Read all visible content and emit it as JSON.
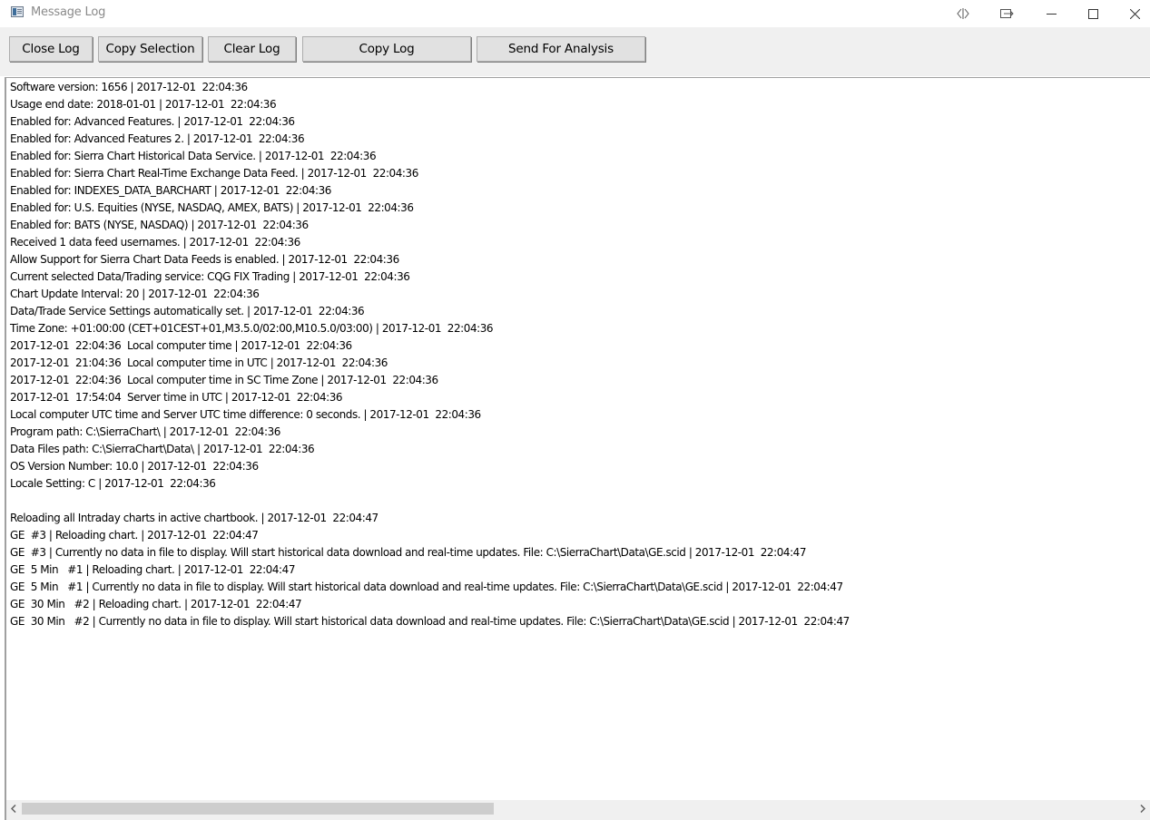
{
  "window": {
    "title": "Message Log",
    "icon": "app-window-icon"
  },
  "titlebar_buttons": [
    {
      "name": "snap-layout-icon",
      "label": ""
    },
    {
      "name": "pin-window-icon",
      "label": ""
    },
    {
      "name": "minimize-icon",
      "label": ""
    },
    {
      "name": "maximize-icon",
      "label": ""
    },
    {
      "name": "close-icon",
      "label": ""
    }
  ],
  "toolbar": {
    "close_log": "Close Log",
    "copy_selection": "Copy Selection",
    "clear_log": "Clear Log",
    "copy_log": "Copy Log",
    "send_for_analysis": "Send For Analysis"
  },
  "log": {
    "lines": [
      "Software version: 1656 | 2017-12-01  22:04:36",
      "Usage end date: 2018-01-01 | 2017-12-01  22:04:36",
      "Enabled for: Advanced Features. | 2017-12-01  22:04:36",
      "Enabled for: Advanced Features 2. | 2017-12-01  22:04:36",
      "Enabled for: Sierra Chart Historical Data Service. | 2017-12-01  22:04:36",
      "Enabled for: Sierra Chart Real-Time Exchange Data Feed. | 2017-12-01  22:04:36",
      "Enabled for: INDEXES_DATA_BARCHART | 2017-12-01  22:04:36",
      "Enabled for: U.S. Equities (NYSE, NASDAQ, AMEX, BATS) | 2017-12-01  22:04:36",
      "Enabled for: BATS (NYSE, NASDAQ) | 2017-12-01  22:04:36",
      "Received 1 data feed usernames. | 2017-12-01  22:04:36",
      "Allow Support for Sierra Chart Data Feeds is enabled. | 2017-12-01  22:04:36",
      "Current selected Data/Trading service: CQG FIX Trading | 2017-12-01  22:04:36",
      "Chart Update Interval: 20 | 2017-12-01  22:04:36",
      "Data/Trade Service Settings automatically set. | 2017-12-01  22:04:36",
      "Time Zone: +01:00:00 (CET+01CEST+01,M3.5.0/02:00,M10.5.0/03:00) | 2017-12-01  22:04:36",
      "2017-12-01  22:04:36  Local computer time | 2017-12-01  22:04:36",
      "2017-12-01  21:04:36  Local computer time in UTC | 2017-12-01  22:04:36",
      "2017-12-01  22:04:36  Local computer time in SC Time Zone | 2017-12-01  22:04:36",
      "2017-12-01  17:54:04  Server time in UTC | 2017-12-01  22:04:36",
      "Local computer UTC time and Server UTC time difference: 0 seconds. | 2017-12-01  22:04:36",
      "Program path: C:\\SierraChart\\ | 2017-12-01  22:04:36",
      "Data Files path: C:\\SierraChart\\Data\\ | 2017-12-01  22:04:36",
      "OS Version Number: 10.0 | 2017-12-01  22:04:36",
      "Locale Setting: C | 2017-12-01  22:04:36",
      "",
      "Reloading all Intraday charts in active chartbook. | 2017-12-01  22:04:47",
      "GE  #3 | Reloading chart. | 2017-12-01  22:04:47",
      "GE  #3 | Currently no data in file to display. Will start historical data download and real-time updates. File: C:\\SierraChart\\Data\\GE.scid | 2017-12-01  22:04:47",
      "GE  5 Min   #1 | Reloading chart. | 2017-12-01  22:04:47",
      "GE  5 Min   #1 | Currently no data in file to display. Will start historical data download and real-time updates. File: C:\\SierraChart\\Data\\GE.scid | 2017-12-01  22:04:47",
      "GE  30 Min   #2 | Reloading chart. | 2017-12-01  22:04:47",
      "GE  30 Min   #2 | Currently no data in file to display. Will start historical data download and real-time updates. File: C:\\SierraChart\\Data\\GE.scid | 2017-12-01  22:04:47"
    ]
  },
  "scrollbar": {
    "left_arrow": "‹",
    "right_arrow": "›"
  }
}
